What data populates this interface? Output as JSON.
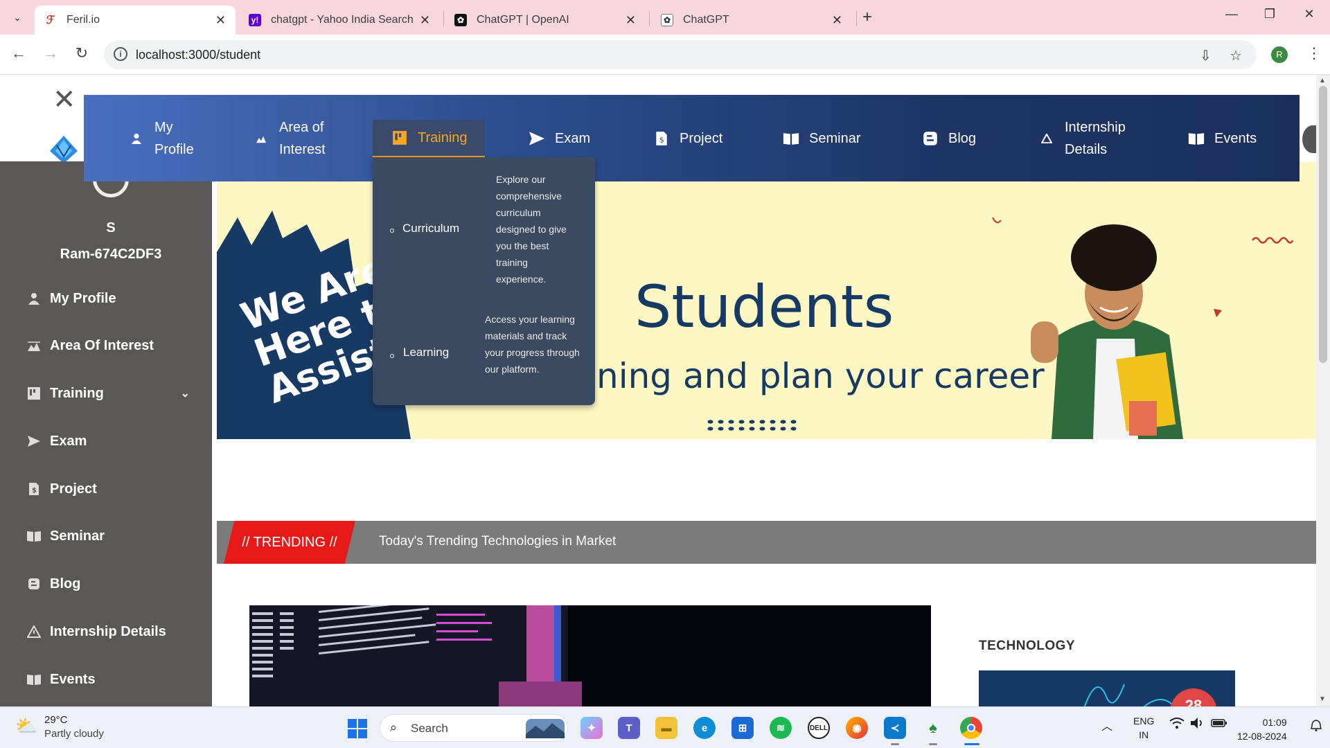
{
  "browser": {
    "tabs": [
      {
        "title": "Feril.io",
        "favicon": "feril-icon",
        "color": "#c0392b",
        "active": true
      },
      {
        "title": "chatgpt - Yahoo India Search Re",
        "favicon": "yahoo-icon",
        "color": "#6001d2",
        "active": false
      },
      {
        "title": "ChatGPT | OpenAI",
        "favicon": "openai-icon",
        "color": "#111111",
        "active": false
      },
      {
        "title": "ChatGPT",
        "favicon": "openai-icon",
        "color": "#555555",
        "active": false
      }
    ],
    "url": "localhost:3000/student",
    "profile_initial": "R"
  },
  "sidebar": {
    "name": "S",
    "id": "Ram-674C2DF3",
    "items": [
      {
        "label": "My Profile",
        "icon": "person-icon"
      },
      {
        "label": "Area Of Interest",
        "icon": "area-icon"
      },
      {
        "label": "Training",
        "icon": "training-icon",
        "has_chevron": true
      },
      {
        "label": "Exam",
        "icon": "send-icon"
      },
      {
        "label": "Project",
        "icon": "project-icon"
      },
      {
        "label": "Seminar",
        "icon": "book-icon"
      },
      {
        "label": "Blog",
        "icon": "blog-icon"
      },
      {
        "label": "Internship Details",
        "icon": "warning-icon"
      },
      {
        "label": "Events",
        "icon": "book-icon"
      }
    ]
  },
  "topnav": {
    "items": [
      {
        "label_1": "My",
        "label_2": "Profile"
      },
      {
        "label_1": "Area of",
        "label_2": "Interest"
      },
      {
        "label": "Training"
      },
      {
        "label": "Exam"
      },
      {
        "label": "Project"
      },
      {
        "label": "Seminar"
      },
      {
        "label": "Blog"
      },
      {
        "label_1": "Internship",
        "label_2": "Details"
      },
      {
        "label": "Events"
      }
    ],
    "active_color": "#f5a623",
    "dropdown": [
      {
        "title": "Curriculum",
        "desc": "Explore our comprehensive curriculum designed to give you the best training experience."
      },
      {
        "title": "Learning",
        "desc": "Access your learning materials and track your progress through our platform."
      }
    ]
  },
  "hero": {
    "slogan_1": "We Are",
    "slogan_2": "Here to",
    "slogan_3": "Assist",
    "title": "Students",
    "subtitle": "ning and plan your career"
  },
  "trending": {
    "tag": "// TRENDING //",
    "text": "Today's Trending Technologies in Market"
  },
  "technology": {
    "heading": "TECHNOLOGY",
    "badge": "28"
  },
  "taskbar": {
    "temp": "29°C",
    "weather": "Partly cloudy",
    "search": "Search",
    "lang_1": "ENG",
    "lang_2": "IN",
    "time": "01:09",
    "date": "12-08-2024"
  }
}
